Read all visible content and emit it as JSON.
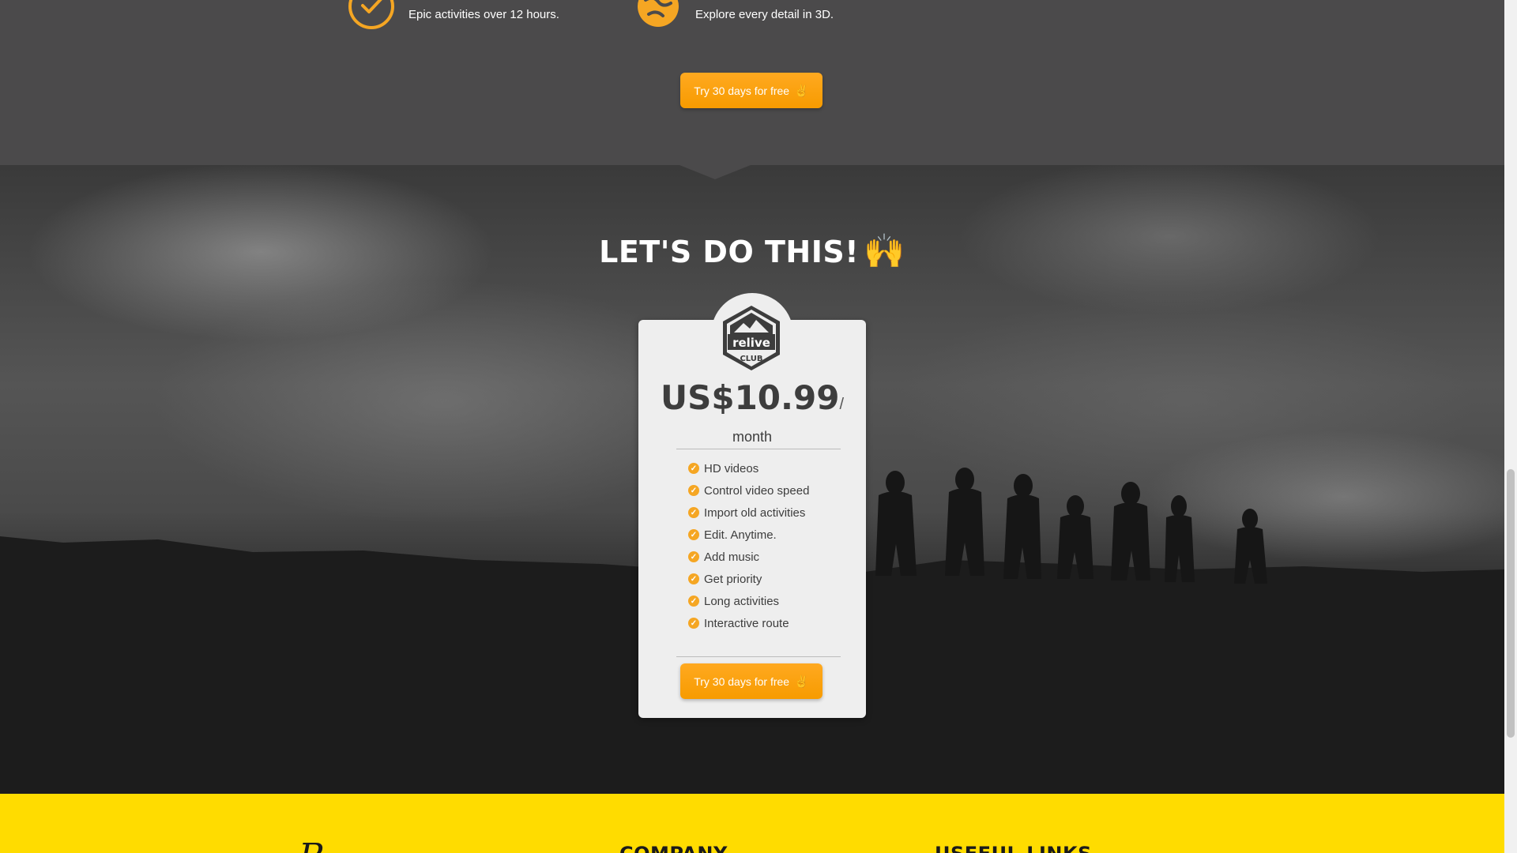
{
  "features": [
    {
      "icon": "check-circle-icon",
      "description": "Epic activities over 12 hours."
    },
    {
      "icon": "globe-3d-icon",
      "description": "Explore every detail in 3D."
    }
  ],
  "cta": {
    "label": "Try 30 days for free",
    "icon": "victory-hand-icon"
  },
  "hero": {
    "title": "LET'S DO THIS!",
    "title_emoji": "🙌"
  },
  "pricing": {
    "badge": {
      "brand": "relive",
      "club": "CLUB"
    },
    "price": "US$10.99",
    "separator": "/",
    "period": "month",
    "features": [
      "HD videos",
      "Control video speed",
      "Import old activities",
      "Edit. Anytime.",
      "Add music",
      "Get priority",
      "Long activities",
      "Interactive route"
    ]
  },
  "footer": {
    "company_heading": "COMPANY",
    "links_heading": "USEFUL LINKS"
  },
  "colors": {
    "accent": "#f79b00",
    "footer_bg": "#ffdc00",
    "band_bg": "#4b4a4b"
  }
}
